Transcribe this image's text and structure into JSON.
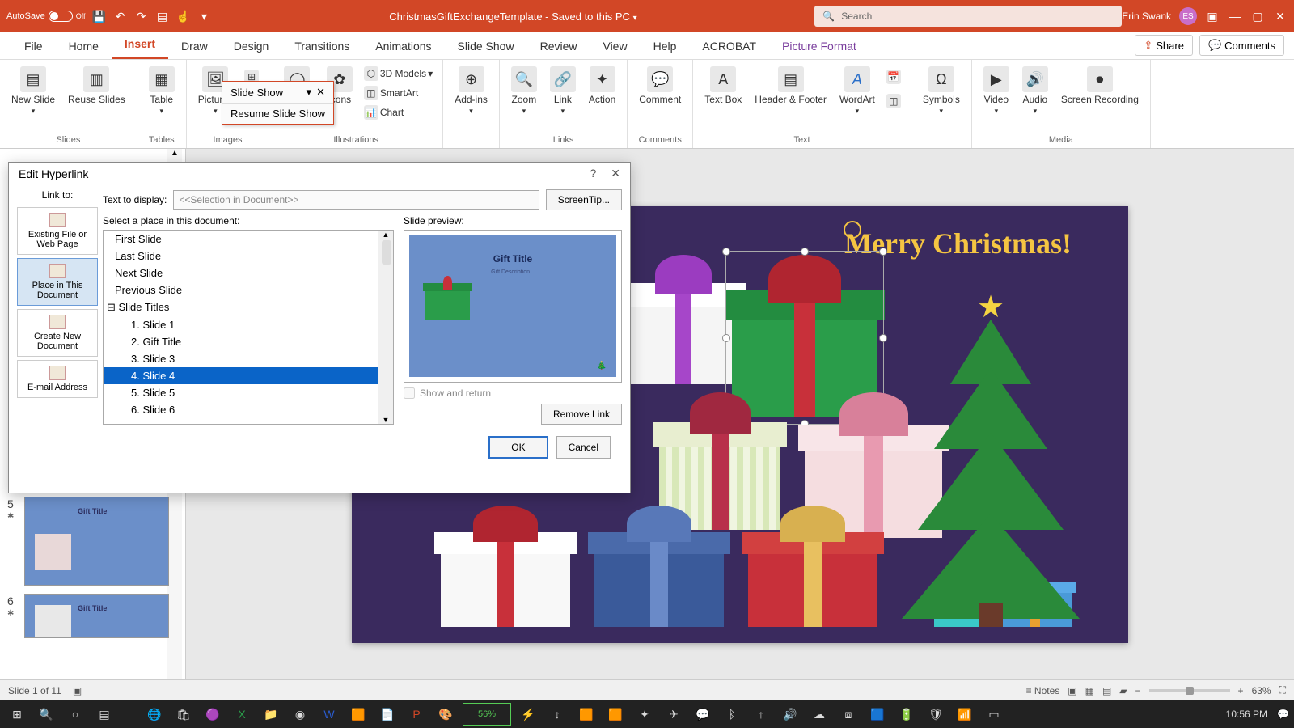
{
  "titlebar": {
    "autosave_label": "AutoSave",
    "autosave_state": "Off",
    "doc_title": "ChristmasGiftExchangeTemplate - Saved to this PC",
    "search_placeholder": "Search",
    "user_name": "Erin Swank",
    "user_initials": "ES"
  },
  "ribbon_tabs": [
    "File",
    "Home",
    "Insert",
    "Draw",
    "Design",
    "Transitions",
    "Animations",
    "Slide Show",
    "Review",
    "View",
    "Help",
    "ACROBAT",
    "Picture Format"
  ],
  "ribbon_tabs_active": "Insert",
  "ribbon_right": {
    "share": "Share",
    "comments": "Comments"
  },
  "ribbon_groups": {
    "slides": {
      "label": "Slides",
      "items": [
        "New Slide",
        "Reuse Slides"
      ]
    },
    "tables": {
      "label": "Tables",
      "items": [
        "Table"
      ]
    },
    "images": {
      "label": "Images",
      "items": [
        "Pictures"
      ]
    },
    "illustrations": {
      "label": "Illustrations",
      "items": [
        "Shapes",
        "Icons"
      ],
      "small": [
        "3D Models",
        "SmartArt",
        "Chart"
      ]
    },
    "addins": {
      "label": "",
      "items": [
        "Add-ins"
      ]
    },
    "links": {
      "label": "Links",
      "items": [
        "Zoom",
        "Link",
        "Action"
      ]
    },
    "comments": {
      "label": "Comments",
      "items": [
        "Comment"
      ]
    },
    "text": {
      "label": "Text",
      "items": [
        "Text Box",
        "Header & Footer",
        "WordArt"
      ]
    },
    "symbols": {
      "label": "",
      "items": [
        "Symbols"
      ]
    },
    "media": {
      "label": "Media",
      "items": [
        "Video",
        "Audio",
        "Screen Recording"
      ]
    }
  },
  "tooltip": {
    "line1": "Slide Show",
    "line2": "Resume Slide Show"
  },
  "dialog": {
    "title": "Edit Hyperlink",
    "link_to_label": "Link to:",
    "link_opts": [
      "Existing File or Web Page",
      "Place in This Document",
      "Create New Document",
      "E-mail Address"
    ],
    "link_opt_selected": 1,
    "text_display_label": "Text to display:",
    "text_display_value": "<<Selection in Document>>",
    "screentip": "ScreenTip...",
    "select_place_label": "Select a place in this document:",
    "places": [
      "First Slide",
      "Last Slide",
      "Next Slide",
      "Previous Slide",
      "Slide Titles",
      "1. Slide 1",
      "2. Gift Title",
      "3. Slide 3",
      "4. Slide 4",
      "5. Slide 5",
      "6. Slide 6"
    ],
    "place_selected": 8,
    "preview_label": "Slide preview:",
    "preview_title": "Gift Title",
    "preview_sub": "Gift Description...",
    "show_return": "Show and return",
    "remove_link": "Remove Link",
    "ok": "OK",
    "cancel": "Cancel"
  },
  "thumbs": [
    {
      "num": "5",
      "title": "Gift Title"
    },
    {
      "num": "6",
      "title": "Gift Title"
    }
  ],
  "slide": {
    "title": "Merry Christmas!"
  },
  "statusbar": {
    "slide_info": "Slide 1 of 11",
    "notes": "Notes",
    "zoom": "63%"
  },
  "taskbar": {
    "battery": "56%",
    "time": "10:56 PM"
  }
}
